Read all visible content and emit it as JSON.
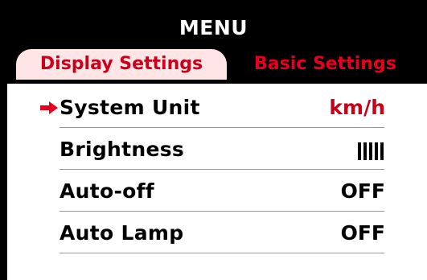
{
  "menu": {
    "title": "MENU"
  },
  "tabs": [
    {
      "label": "Display Settings",
      "active": true
    },
    {
      "label": "Basic Settings",
      "active": false
    }
  ],
  "settings": [
    {
      "label": "System Unit",
      "value": "km/h",
      "selected": true
    },
    {
      "label": "Brightness",
      "value_level": 5,
      "value_icon": "brightness-level-bars"
    },
    {
      "label": "Auto-off",
      "value": "OFF"
    },
    {
      "label": "Auto Lamp",
      "value": "OFF"
    }
  ],
  "colors": {
    "accent": "#c8001a",
    "tab_active_bg": "#ffe5e5",
    "header_bg": "#000000"
  }
}
